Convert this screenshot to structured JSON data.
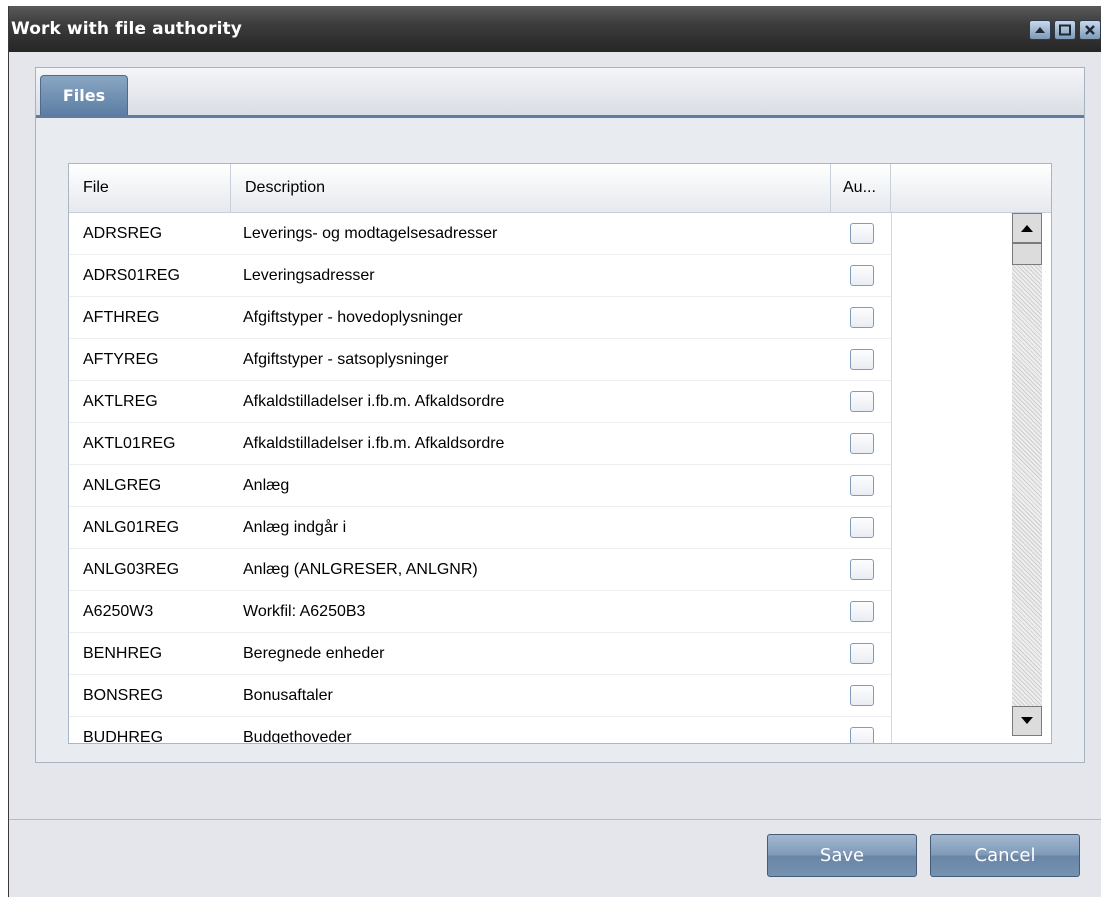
{
  "window": {
    "title": "Work with file authority",
    "controls": [
      "minimize-icon",
      "maximize-icon",
      "close-icon"
    ]
  },
  "tabs": [
    {
      "label": "Files",
      "active": true
    }
  ],
  "table": {
    "columns": [
      "File",
      "Description",
      "Au..."
    ],
    "rows": [
      {
        "file": "ADRSREG",
        "description": "Leverings- og modtagelsesadresser",
        "checked": false
      },
      {
        "file": "ADRS01REG",
        "description": "Leveringsadresser",
        "checked": false
      },
      {
        "file": "AFTHREG",
        "description": "Afgiftstyper - hovedoplysninger",
        "checked": false
      },
      {
        "file": "AFTYREG",
        "description": "Afgiftstyper - satsoplysninger",
        "checked": false
      },
      {
        "file": "AKTLREG",
        "description": "Afkaldstilladelser i.fb.m. Afkaldsordre",
        "checked": false
      },
      {
        "file": "AKTL01REG",
        "description": "Afkaldstilladelser i.fb.m. Afkaldsordre",
        "checked": false
      },
      {
        "file": "ANLGREG",
        "description": "Anlæg",
        "checked": false
      },
      {
        "file": "ANLG01REG",
        "description": "Anlæg indgår i",
        "checked": false
      },
      {
        "file": "ANLG03REG",
        "description": "Anlæg (ANLGRESER, ANLGNR)",
        "checked": false
      },
      {
        "file": "A6250W3",
        "description": "Workfil: A6250B3",
        "checked": false
      },
      {
        "file": "BENHREG",
        "description": "Beregnede enheder",
        "checked": false
      },
      {
        "file": "BONSREG",
        "description": "Bonusaftaler",
        "checked": false
      },
      {
        "file": "BUDHREG",
        "description": "Budgethoveder",
        "checked": false
      }
    ]
  },
  "buttons": {
    "save": "Save",
    "cancel": "Cancel"
  }
}
